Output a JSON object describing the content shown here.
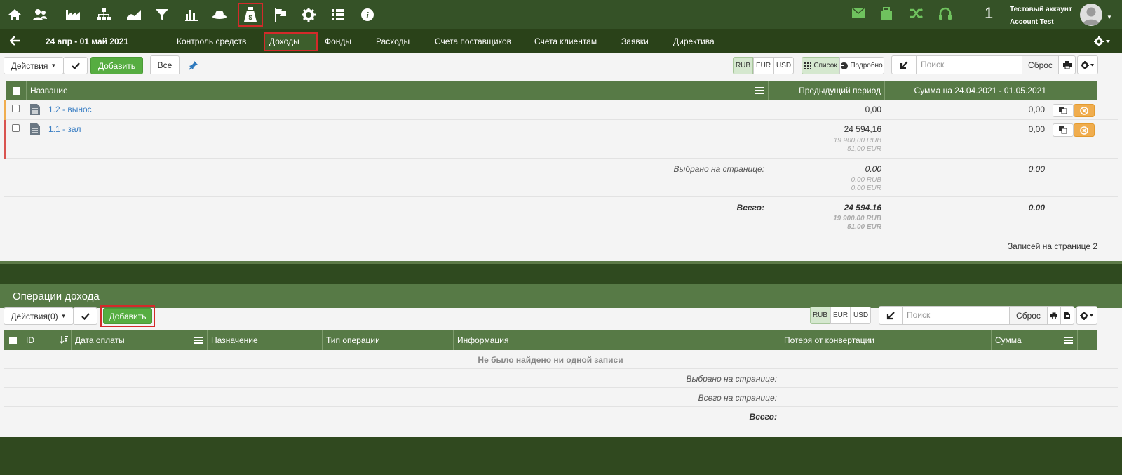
{
  "header": {
    "account_name": "Тестовый аккаунт",
    "account_id": "Account Test",
    "notification_count": "1",
    "icons": [
      "home-icon",
      "users-icon",
      "factory-icon",
      "org-icon",
      "area-chart-icon",
      "filter-icon",
      "bar-chart-icon",
      "hat-icon",
      "money-bag-icon",
      "flag-icon",
      "gear-icon",
      "list-icon",
      "info-icon"
    ]
  },
  "nav": {
    "date_range": "24 апр - 01 май 2021",
    "items": [
      "Контроль средств",
      "Доходы",
      "Фонды",
      "Расходы",
      "Счета поставщиков",
      "Счета клиентам",
      "Заявки",
      "Директива"
    ],
    "active": "Доходы"
  },
  "toolbar1": {
    "actions_label": "Действия",
    "add_label": "Добавить",
    "all_tab": "Все",
    "currencies": [
      "RUB",
      "EUR",
      "USD"
    ],
    "view_list": "Список",
    "view_detail": "Подробно",
    "search_placeholder": "Поиск",
    "reset_label": "Сброс"
  },
  "table1": {
    "headers": {
      "name": "Название",
      "prev": "Предыдущий период",
      "sum": "Сумма на 24.04.2021 - 01.05.2021"
    },
    "rows": [
      {
        "name": "1.2 - вынос",
        "prev": "0,00",
        "sum": "0,00",
        "prev_rub": "",
        "prev_eur": "",
        "marker": "#f0ad4e"
      },
      {
        "name": "1.1 - зал",
        "prev": "24 594,16",
        "sum": "0,00",
        "prev_rub": "19 900,00 RUB",
        "prev_eur": "51,00 EUR",
        "marker": "#d9534f"
      }
    ],
    "selected_label": "Выбрано на странице:",
    "selected_prev": "0.00",
    "selected_sum": "0.00",
    "selected_rub": "0.00 RUB",
    "selected_eur": "0.00 EUR",
    "total_label": "Всего:",
    "total_prev": "24 594.16",
    "total_sum": "0.00",
    "total_rub": "19 900.00 RUB",
    "total_eur": "51.00 EUR",
    "records_label": "Записей на странице 2"
  },
  "panel2": {
    "title": "Операции дохода",
    "actions_label": "Действия(0)",
    "add_label": "Добавить",
    "currencies": [
      "RUB",
      "EUR",
      "USD"
    ],
    "search_placeholder": "Поиск",
    "reset_label": "Сброс",
    "headers": [
      "ID",
      "Дата оплаты",
      "Назначение",
      "Тип операции",
      "Информация",
      "Потеря от конвертации",
      "Сумма"
    ],
    "empty_message": "Не было найдено ни одной записи",
    "selected_label": "Выбрано на странице:",
    "page_total_label": "Всего на странице:",
    "total_label": "Всего:"
  },
  "colors": {
    "brand_dark": "#355227",
    "header_green": "#577a46",
    "accent_green": "#56ad41",
    "link": "#3b7fc4",
    "highlight": "#d32a2a"
  }
}
